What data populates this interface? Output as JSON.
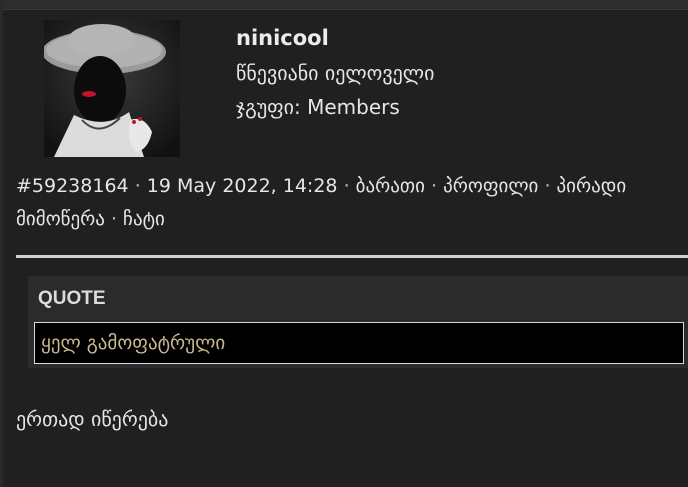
{
  "post": {
    "author": {
      "username": "ninicool",
      "rank": "წნევიანი იელოველი",
      "group": "ჯგუფი: Members"
    },
    "meta": {
      "post_id": "#59238164",
      "date": "19 May 2022, 14:28",
      "separator": "·",
      "links": {
        "card": "ბარათი",
        "profile": "პროფილი",
        "private": "პირადი",
        "correspondence": "მიმოწერა",
        "chat": "ჩატი"
      }
    },
    "quote": {
      "title": "QUOTE",
      "text": "ყელ გამოფატრული"
    },
    "body": "ერთად იწერება"
  },
  "colors": {
    "background": "#202020",
    "quote_panel": "#2b2b2b",
    "quote_box": "#000000",
    "quote_text": "#cbb98f",
    "text": "#e6e6e6"
  }
}
